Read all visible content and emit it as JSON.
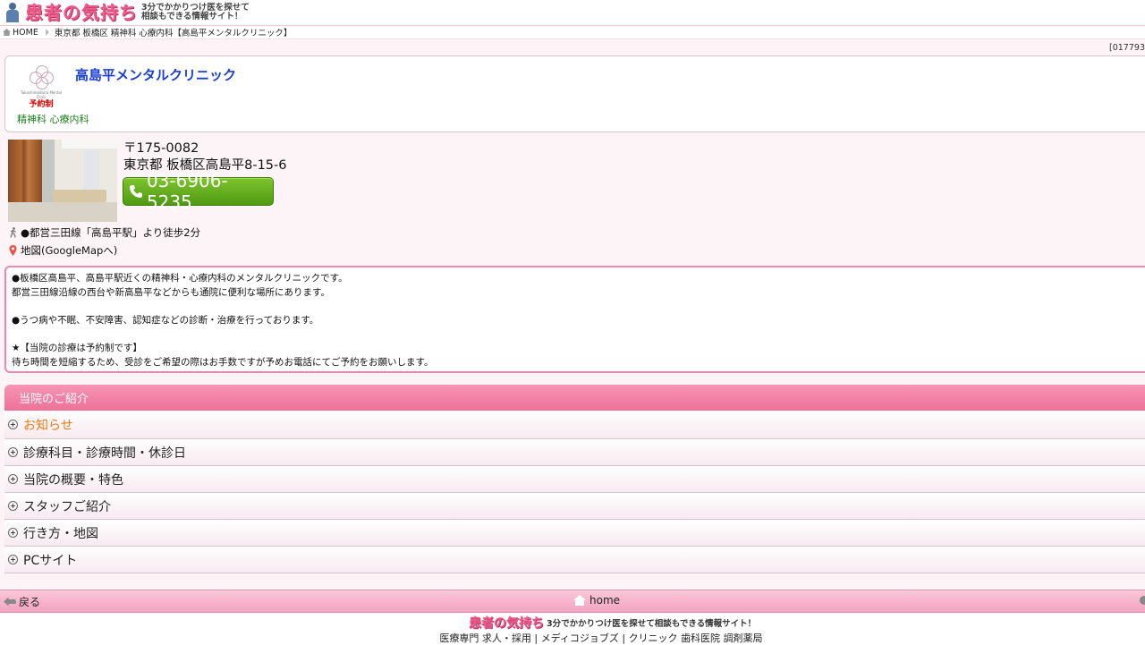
{
  "header": {
    "logo_main": "患者の気持ち",
    "logo_sub_line1": "3分でかかりつけ医を探せて",
    "logo_sub_line2": "相談もできる情報サイト！"
  },
  "breadcrumb": {
    "home": "HOME",
    "path": "東京都 板橋区 精神科 心療内科【高島平メンタルクリニック】"
  },
  "page_id": "[017793",
  "clinic": {
    "name": "高島平メンタルクリニック",
    "logo_text": "Takashimadaira Mental Clinic",
    "reserve_badge": "予約制",
    "departments": "精神科 心療内科",
    "postal": "〒175-0082",
    "address": "東京都 板橋区高島平8-15-6",
    "phone": "03-6906-5235",
    "access": "●都営三田線「高島平駅」より徒歩2分",
    "map_link": "地図(GoogleMapへ)"
  },
  "description": {
    "p1_line1": "●板橋区高島平、高島平駅近くの精神科・心療内科のメンタルクリニックです。",
    "p1_line2": "都営三田線沿線の西台や新高島平などからも通院に便利な場所にあります。",
    "p2": "●うつ病や不眠、不安障害、認知症などの診断・治療を行っております。",
    "p3_line1": "★【当院の診療は予約制です】",
    "p3_line2": "待ち時間を短縮するため、受診をご希望の際はお手数ですが予めお電話にてご予約をお願いします。"
  },
  "menu": {
    "heading": "当院のご紹介",
    "items": [
      {
        "label": "お知らせ"
      },
      {
        "label": "診療科目・診療時間・休診日"
      },
      {
        "label": "当院の概要・特色"
      },
      {
        "label": "スタッフご紹介"
      },
      {
        "label": "行き方・地図"
      },
      {
        "label": "PCサイト"
      }
    ]
  },
  "footer": {
    "back": "戻る",
    "home": "home",
    "logo_main": "患者の気持ち",
    "logo_sub": "3分でかかりつけ医を探せて相談もできる情報サイト！",
    "links": [
      "医療専門",
      "求人・採用",
      "メディコジョブズ",
      "クリニック",
      "歯科医院",
      "調剤薬局"
    ]
  },
  "colors": {
    "brand_pink": "#ef5c8c",
    "menu_header": "#ee7198",
    "clinic_name": "#1a3fd6",
    "department": "#1c7c1c",
    "phone_button": "#5fae1a",
    "highlight_orange": "#f07a16"
  },
  "icons": [
    "person-logo-icon",
    "home-icon",
    "clover-logo-icon",
    "phone-icon",
    "walking-icon",
    "map-pin-icon",
    "plus-circle-icon",
    "back-arrow-icon",
    "house-icon",
    "forward-arrow-icon"
  ]
}
